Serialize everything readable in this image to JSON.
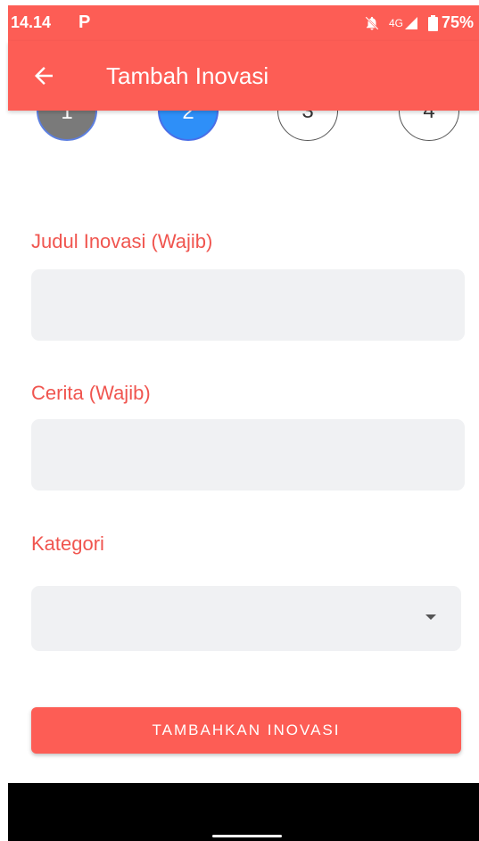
{
  "status_bar": {
    "time": "14.14",
    "app_icon": "P",
    "network": "4G",
    "battery": "75%"
  },
  "app_bar": {
    "title": "Tambah Inovasi"
  },
  "stepper": {
    "steps": [
      "1",
      "2",
      "3",
      "4"
    ],
    "active_step": 2
  },
  "form": {
    "judul_label": "Judul Inovasi (Wajib)",
    "judul_value": "",
    "cerita_label": "Cerita (Wajib)",
    "cerita_value": "",
    "kategori_label": "Kategori",
    "kategori_value": ""
  },
  "submit_label": "TAMBAHKAN INOVASI",
  "colors": {
    "primary": "#fd5d55",
    "label": "#f0554f",
    "active_step": "#2e8ff8",
    "done_step": "#7a7a7a",
    "field_bg": "#f0f1f3"
  }
}
